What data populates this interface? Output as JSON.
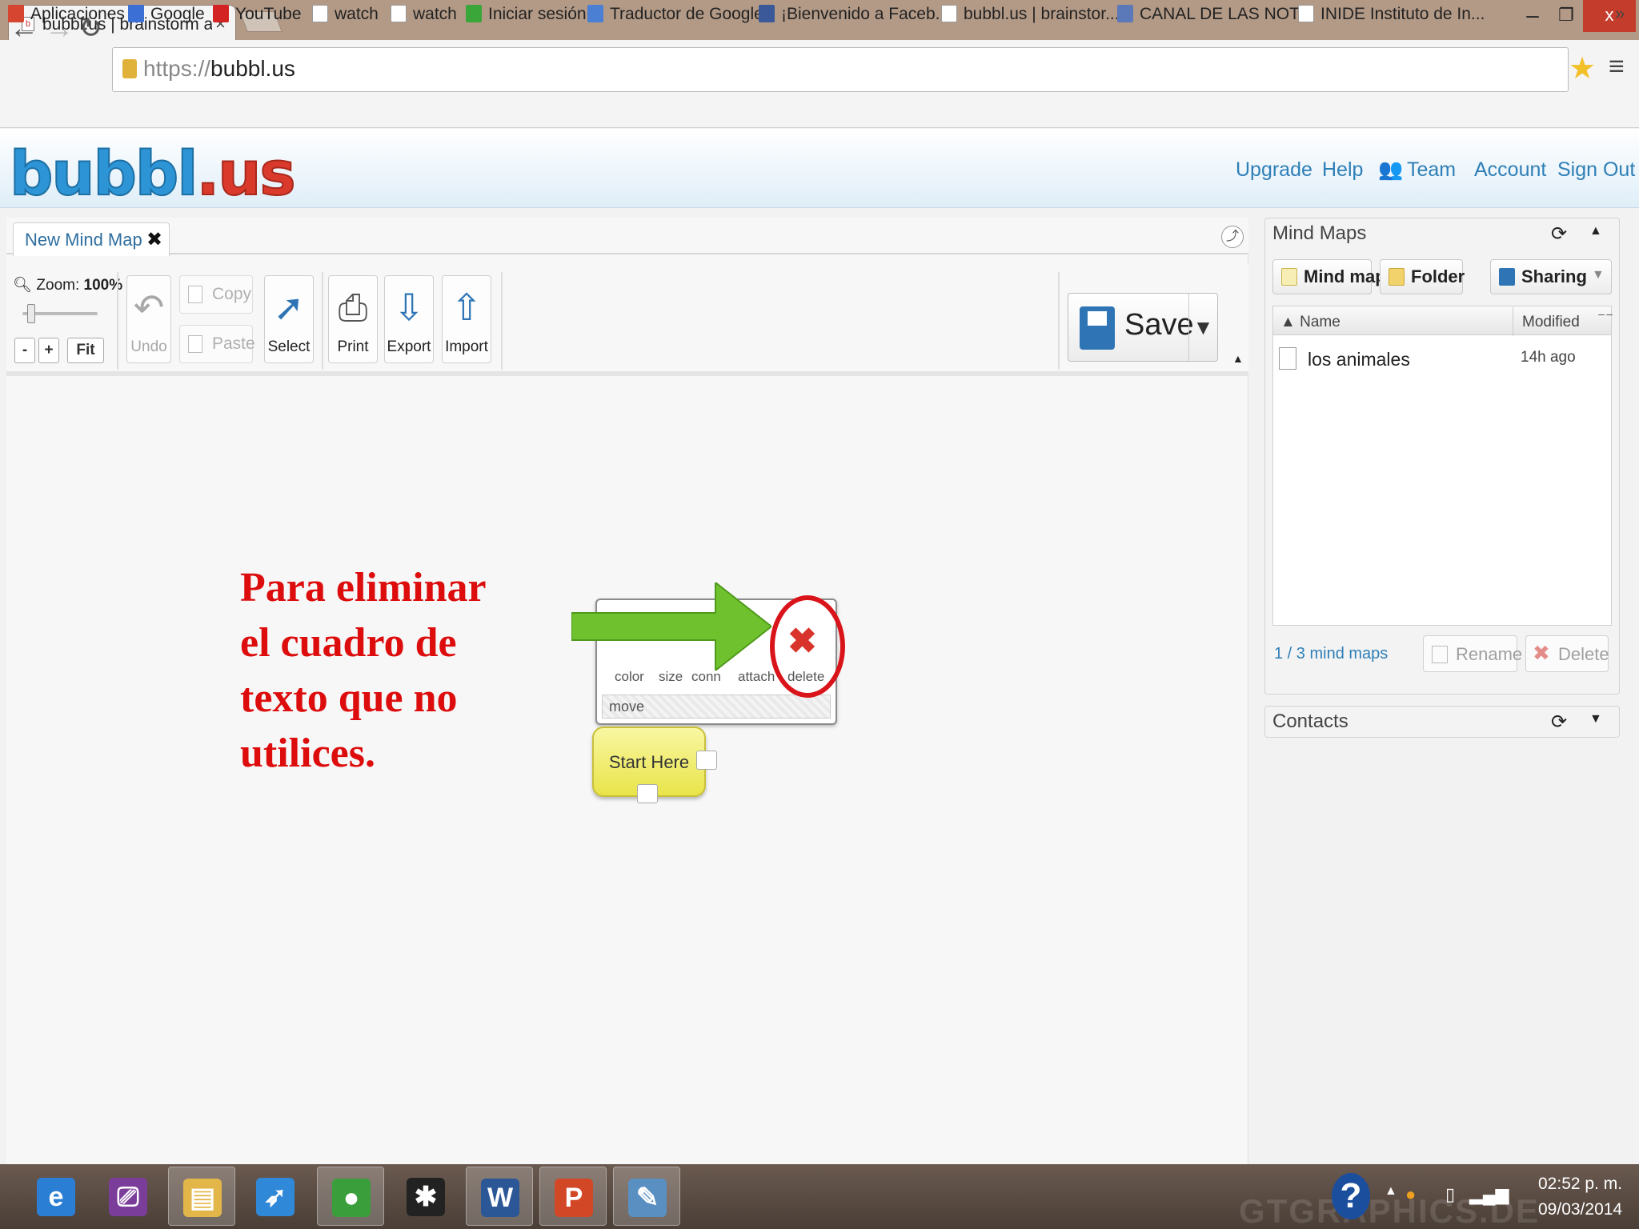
{
  "browser": {
    "tab_title": "bubbl.us | brainstorm and",
    "tab_close": "×",
    "url_protocol": "https://",
    "url_host": "bubbl.us",
    "window_min": "–",
    "window_max": "❐",
    "window_close": "x",
    "bookmarks": [
      {
        "label": "Aplicaciones",
        "icon": "apps-grid-icon",
        "color": "#d6452f"
      },
      {
        "label": "Google",
        "icon": "google-icon",
        "color": "#3b6fd6"
      },
      {
        "label": "YouTube",
        "icon": "youtube-icon",
        "color": "#d32323"
      },
      {
        "label": "watch",
        "icon": "page-icon",
        "color": "#ffffff"
      },
      {
        "label": "watch",
        "icon": "page-icon",
        "color": "#ffffff"
      },
      {
        "label": "Iniciar sesión",
        "icon": "windows-icon",
        "color": "#3aa63a"
      },
      {
        "label": "Traductor de Google",
        "icon": "translate-icon",
        "color": "#4a7fd4"
      },
      {
        "label": "¡Bienvenido a Faceb...",
        "icon": "facebook-icon",
        "color": "#3b5998"
      },
      {
        "label": "bubbl.us | brainstor...",
        "icon": "bubblus-icon",
        "color": "#ffffff"
      },
      {
        "label": "CANAL DE LAS NOT...",
        "icon": "thumbs-up-icon",
        "color": "#5b79b8"
      },
      {
        "label": "INIDE Instituto de In...",
        "icon": "inide-icon",
        "color": "#ffffff"
      }
    ],
    "bookmarks_more": "»"
  },
  "app": {
    "logo_main": "bubbl",
    "logo_dot": ".us",
    "nav": [
      "Upgrade",
      "Help",
      "Team",
      "Account",
      "Sign Out"
    ],
    "doc_tab": "New Mind Map",
    "doc_tab_close": "✖",
    "zoom_label": "Zoom:",
    "zoom_value": "100%",
    "zoom_minus": "-",
    "zoom_plus": "+",
    "zoom_fit": "Fit",
    "toolbar": {
      "undo": "Undo",
      "copy": "Copy",
      "paste": "Paste",
      "select": "Select",
      "print": "Print",
      "export": "Export",
      "import": "Import",
      "save": "Save"
    },
    "node_menu": {
      "labels": [
        "color",
        "size",
        "conn",
        "attach",
        "delete"
      ],
      "move": "move"
    },
    "start_node": "Start Here",
    "instruction": [
      "Para eliminar",
      "el cuadro de",
      "texto que no",
      "utilices."
    ]
  },
  "panel": {
    "maps_title": "Mind Maps",
    "btn_mindmap": "Mind map",
    "btn_folder": "Folder",
    "btn_sharing": "Sharing",
    "col_name": "Name",
    "col_modified": "Modified",
    "rows": [
      {
        "name": "los animales",
        "modified": "14h ago"
      }
    ],
    "count": "1 / 3 mind maps",
    "btn_rename": "Rename",
    "btn_delete": "Delete",
    "contacts_title": "Contacts"
  },
  "taskbar": {
    "time": "02:52 p. m.",
    "date": "09/03/2014",
    "watermark": "GTGRAPHICS.DE",
    "apps": [
      {
        "name": "internet-explorer",
        "glyph": "e",
        "color": "#2a7fd4"
      },
      {
        "name": "presenter",
        "glyph": "⎚",
        "color": "#7a3d9a"
      },
      {
        "name": "file-explorer",
        "glyph": "▤",
        "color": "#e3b64a"
      },
      {
        "name": "rocket",
        "glyph": "➶",
        "color": "#2f88d8"
      },
      {
        "name": "chrome",
        "glyph": "●",
        "color": "#3a9f3a"
      },
      {
        "name": "app-dark",
        "glyph": "✱",
        "color": "#222222"
      },
      {
        "name": "word",
        "glyph": "W",
        "color": "#2b5797"
      },
      {
        "name": "powerpoint",
        "glyph": "P",
        "color": "#d24726"
      },
      {
        "name": "paint",
        "glyph": "✎",
        "color": "#5a8fc2"
      }
    ]
  },
  "colors": {
    "instruction_red": "#dd0d0d",
    "arrow_green": "#6fc22d",
    "circle_red": "#d9141a",
    "link_blue": "#2e7fb7"
  }
}
